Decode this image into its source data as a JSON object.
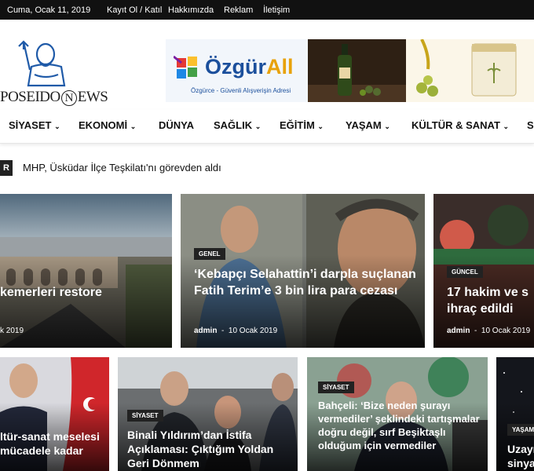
{
  "topbar": {
    "date": "Cuma, Ocak 11, 2019",
    "links": [
      "Kayıt Ol / Katıl",
      "Hakkımızda",
      "Reklam",
      "İletişim"
    ]
  },
  "logo": {
    "text_left": "POSEIDO",
    "text_mid": "N",
    "text_right": "EWS"
  },
  "banner": {
    "brand_main": "Özgür",
    "brand_accent": "All",
    "slogan": "Özgürce - Güvenli Alışverişin Adresi"
  },
  "nav": {
    "items": [
      "SİYASET",
      "EKONOMİ",
      "DÜNYA",
      "SAĞLIK",
      "EĞİTİM",
      "YAŞAM",
      "KÜLTÜR & SANAT",
      "SI"
    ]
  },
  "ticker": {
    "label": "R",
    "headline": "MHP, Üsküdar İlçe Teşkilatı'nı görevden aldı"
  },
  "cards": [
    {
      "title": "kemerleri restore",
      "date": "k 2019"
    },
    {
      "category": "GENEL",
      "title": "‘Kebapçı Selahattin’i darpla suçlanan Fatih Terim’e 3 bin lira para cezası",
      "author": "admin",
      "date": "10 Ocak 2019"
    },
    {
      "category": "GÜNCEL",
      "title": "17 hakim ve s ihraç edildi",
      "author": "admin",
      "date": "10 Ocak 2019"
    },
    {
      "title": "ltür-sanat meselesi mücadele kadar"
    },
    {
      "category": "SİYASET",
      "title": "Binali Yıldırım’dan İstifa Açıklaması: Çıktığım Yoldan Geri Dönmem"
    },
    {
      "category": "SİYASET",
      "title": "Bahçeli: ‘Bize neden şurayı vermediler’ şeklindeki tartışmalar doğru değil, sırf Beşiktaşlı olduğum için vermediler"
    },
    {
      "category": "YAŞAM",
      "title": "Uzayı sinyal"
    }
  ]
}
